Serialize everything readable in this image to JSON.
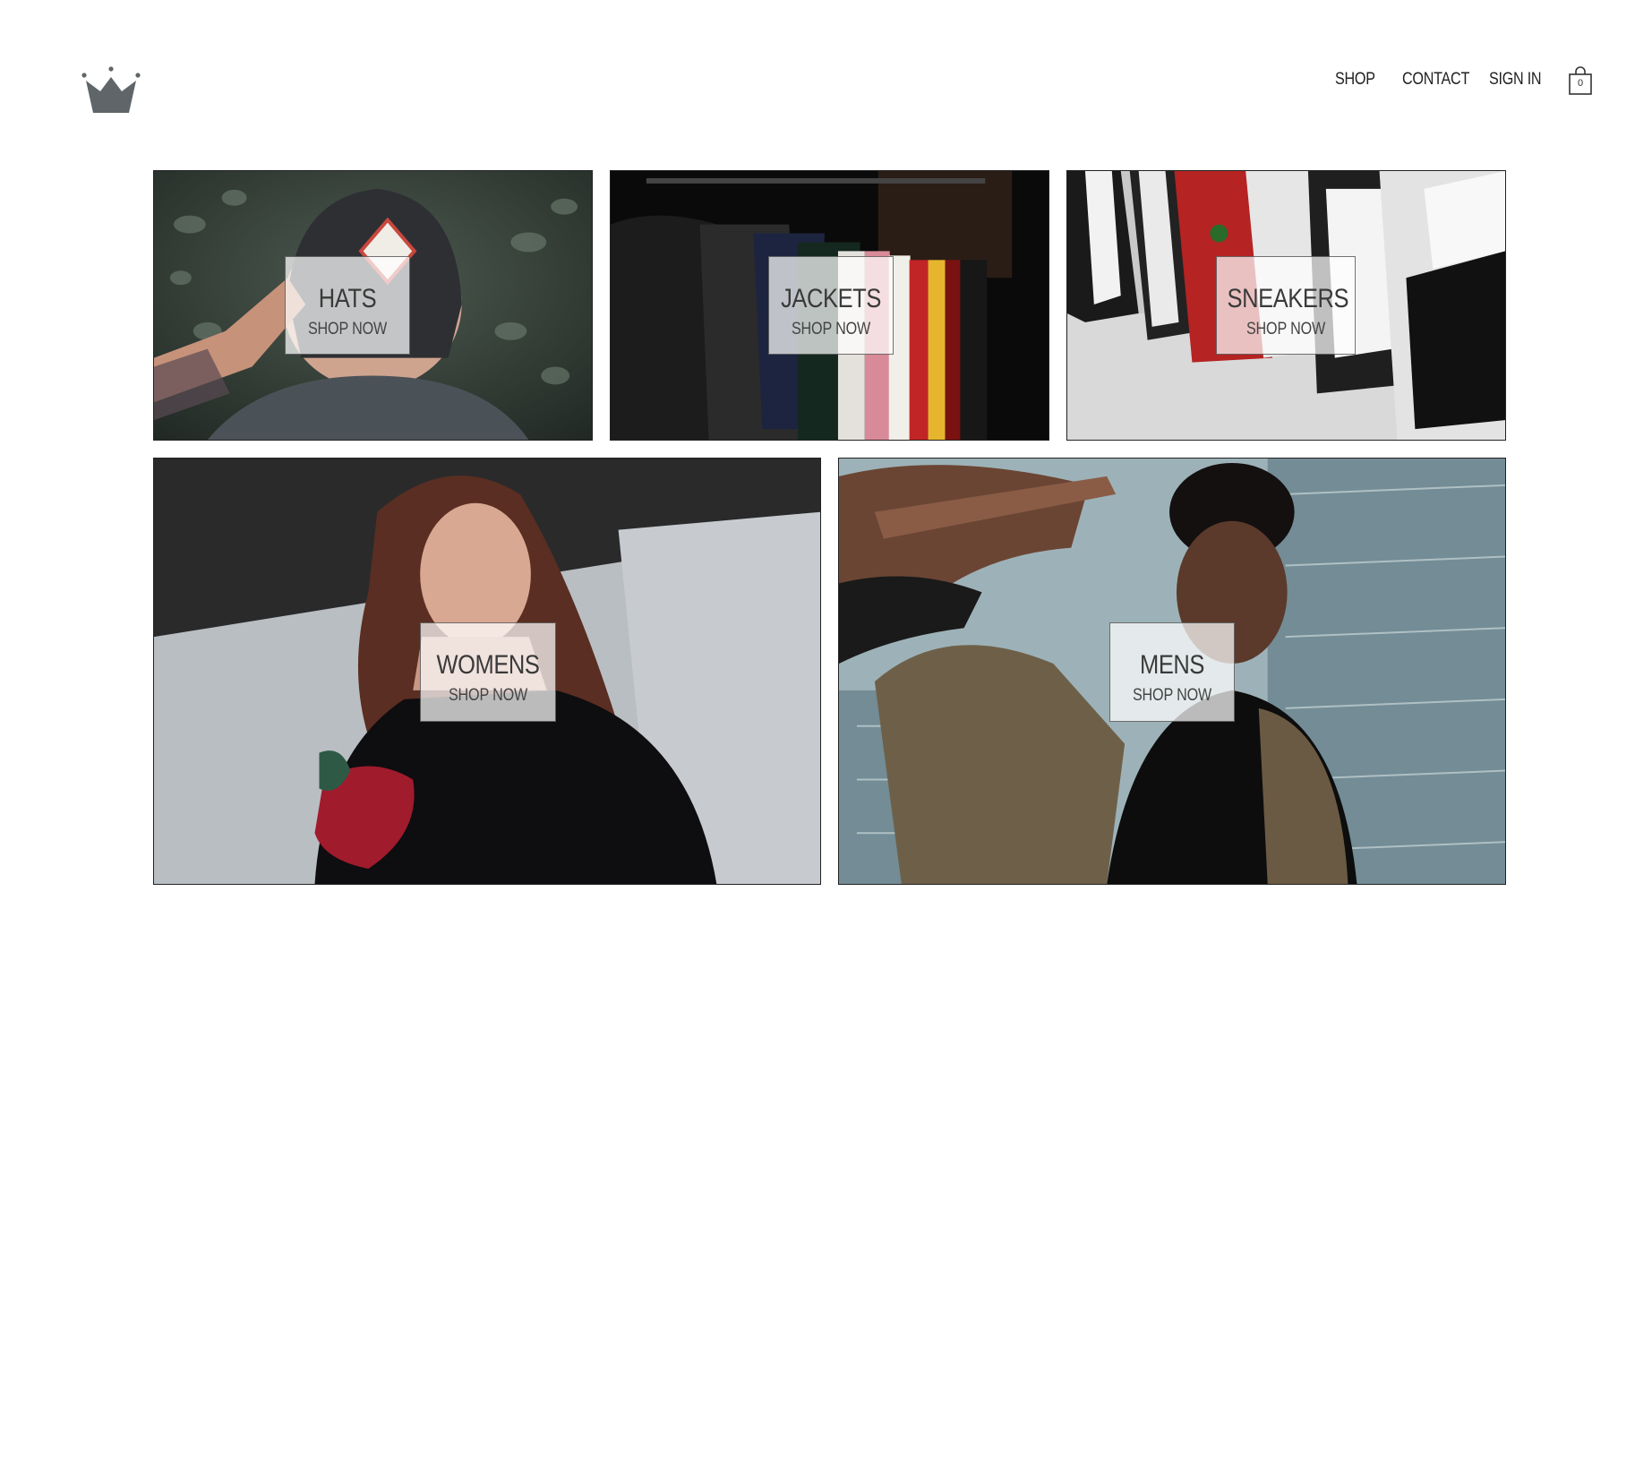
{
  "header": {
    "logo_icon": "crown-icon",
    "nav": [
      {
        "label": "SHOP"
      },
      {
        "label": "CONTACT"
      },
      {
        "label": "SIGN IN"
      }
    ],
    "cart": {
      "icon": "shopping-bag-icon",
      "count": "0"
    }
  },
  "categories": [
    {
      "title": "HATS",
      "cta": "SHOP NOW"
    },
    {
      "title": "JACKETS",
      "cta": "SHOP NOW"
    },
    {
      "title": "SNEAKERS",
      "cta": "SHOP NOW"
    },
    {
      "title": "WOMENS",
      "cta": "SHOP NOW"
    },
    {
      "title": "MENS",
      "cta": "SHOP NOW"
    }
  ],
  "colors": {
    "background": "#ffffff",
    "text": "#222222",
    "logo": "#5f6568"
  }
}
